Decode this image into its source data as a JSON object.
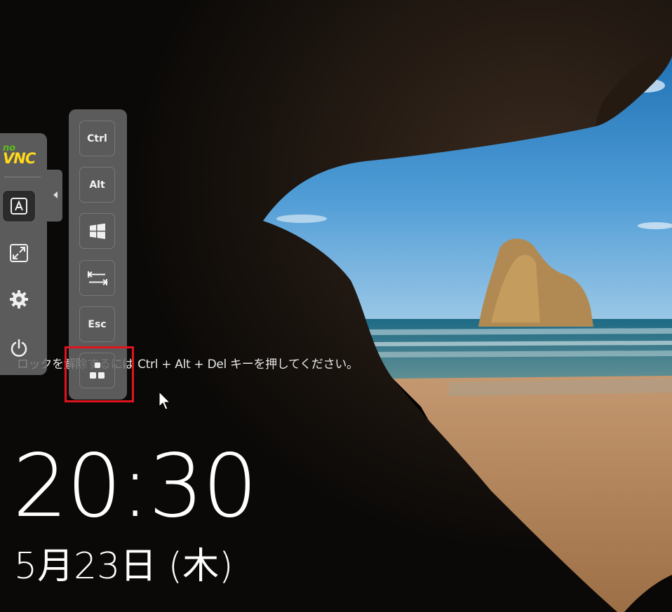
{
  "lock_screen": {
    "hint": "ロックを解除するには Ctrl + Alt + Del キーを押してください。",
    "time": "20:30",
    "date": "5月23日 (木)"
  },
  "novnc": {
    "logo_no": "no",
    "logo_vnc": "VNC",
    "buttons": [
      {
        "icon": "keyboard-a-icon",
        "selected": true
      },
      {
        "icon": "fullscreen-icon",
        "selected": false
      },
      {
        "icon": "gear-icon",
        "selected": false
      },
      {
        "icon": "power-icon",
        "selected": false
      }
    ],
    "handle_icon": "collapse-arrow-icon"
  },
  "extra_keys": {
    "ctrl": "Ctrl",
    "alt": "Alt",
    "windows_icon": "windows-icon",
    "tab_icon": "tab-icon",
    "esc": "Esc",
    "ctrl_alt_del_icon": "ctrl-alt-del-icon"
  },
  "colors": {
    "panel": "#6e6e6e",
    "highlight": "#e0141e",
    "logo_green": "#5cbf1b",
    "logo_yellow": "#ffd91a"
  }
}
